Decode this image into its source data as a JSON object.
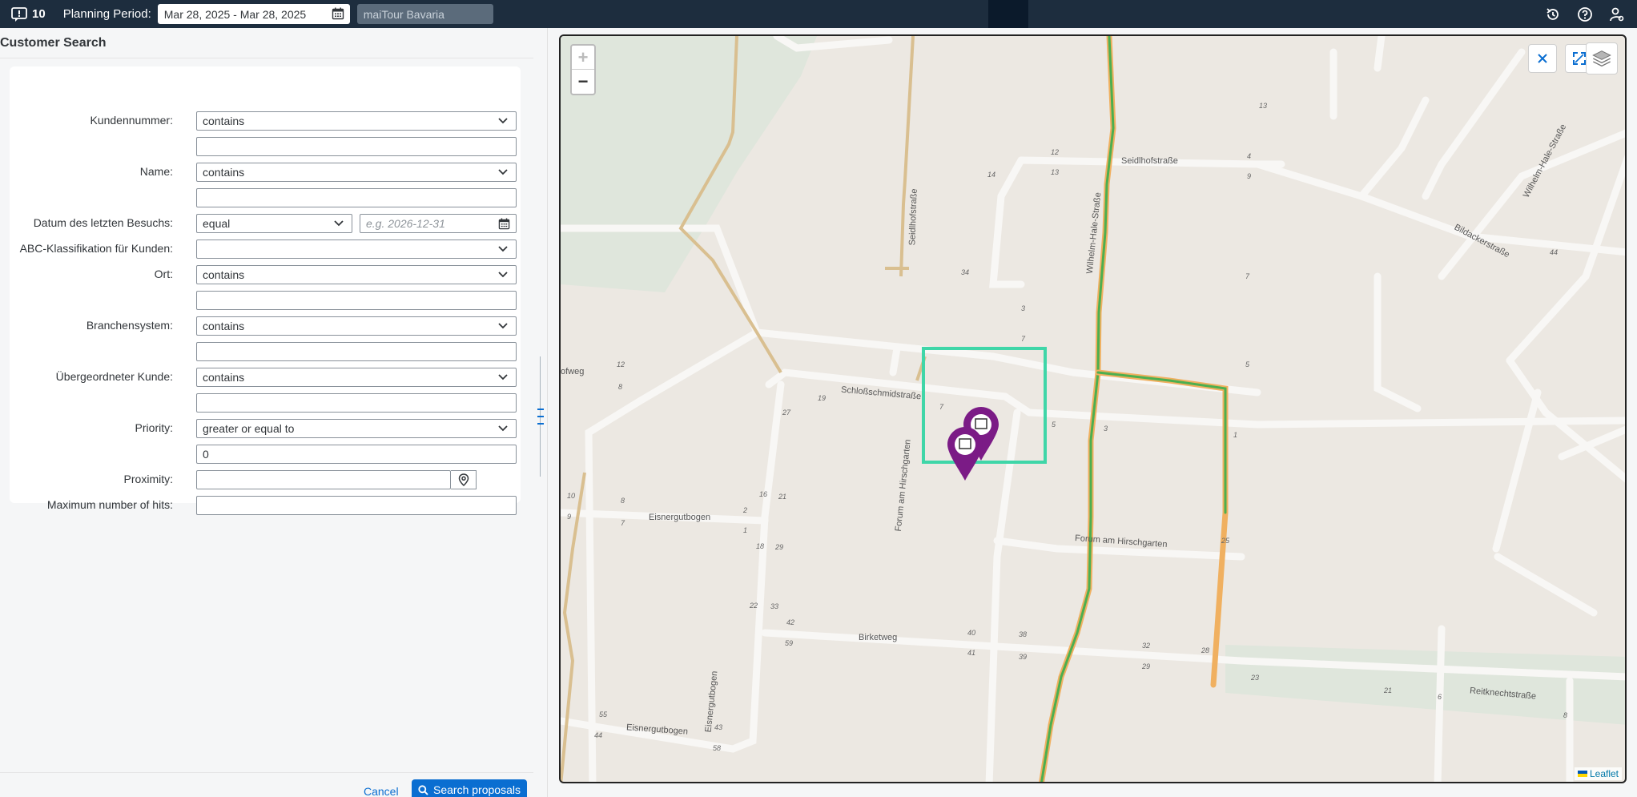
{
  "topbar": {
    "badge_count": "10",
    "planning_label": "Planning Period:",
    "planning_value": "Mar 28, 2025 - Mar 28, 2025",
    "tour_value": "maiTour Bavaria"
  },
  "panel": {
    "title": "Customer Search",
    "fields": {
      "kundennummer": {
        "label": "Kundennummer:",
        "operator": "contains",
        "value": ""
      },
      "name": {
        "label": "Name:",
        "operator": "contains",
        "value": ""
      },
      "datum": {
        "label": "Datum des letzten Besuchs:",
        "operator": "equal",
        "placeholder": "e.g. 2026-12-31"
      },
      "abc": {
        "label": "ABC-Klassifikation für Kunden:",
        "value": ""
      },
      "ort": {
        "label": "Ort:",
        "operator": "contains",
        "value": ""
      },
      "branche": {
        "label": "Branchensystem:",
        "operator": "contains",
        "value": ""
      },
      "uebergeordnet": {
        "label": "Übergeordneter Kunde:",
        "operator": "contains",
        "value": ""
      },
      "priority": {
        "label": "Priority:",
        "operator": "greater or equal to",
        "value": "0"
      },
      "proximity": {
        "label": "Proximity:",
        "value": ""
      },
      "maxhits": {
        "label": "Maximum number of hits:",
        "value": ""
      }
    },
    "cancel_label": "Cancel",
    "search_label": "Search proposals"
  },
  "map": {
    "streets": [
      {
        "name": "Seidlhofstraße"
      },
      {
        "name": "Seidlhofstraße (vertical)",
        "label": "Seidlhofstraße"
      },
      {
        "name": "Wilhelm-Hale-Straße"
      },
      {
        "name": "Bildackerstraße"
      },
      {
        "name": "Schloßschmidstraße"
      },
      {
        "name": "Forum am Hirschgarten"
      },
      {
        "name": "Eisnergutbogen"
      },
      {
        "name": "Birketweg"
      },
      {
        "name": "Reitknechtstraße"
      },
      {
        "name": "ofweg"
      }
    ],
    "house_numbers": [
      "12",
      "13",
      "14",
      "4",
      "9",
      "13",
      "34",
      "3",
      "7",
      "12",
      "8",
      "19",
      "7",
      "5",
      "3",
      "1",
      "27",
      "7",
      "5",
      "16",
      "21",
      "10",
      "8",
      "9",
      "7",
      "2",
      "1",
      "18",
      "29",
      "22",
      "33",
      "42",
      "59",
      "40",
      "38",
      "41",
      "39",
      "32",
      "29",
      "28",
      "23",
      "21",
      "6",
      "8",
      "25",
      "55",
      "44",
      "43",
      "58",
      "44"
    ],
    "zoom_in": "+",
    "zoom_out": "−",
    "attribution": "Leaflet",
    "colors": {
      "selection": "#3fd6a8",
      "marker": "#7b1b86",
      "route_green": "#4caf50",
      "route_orange": "#f0a030"
    }
  }
}
